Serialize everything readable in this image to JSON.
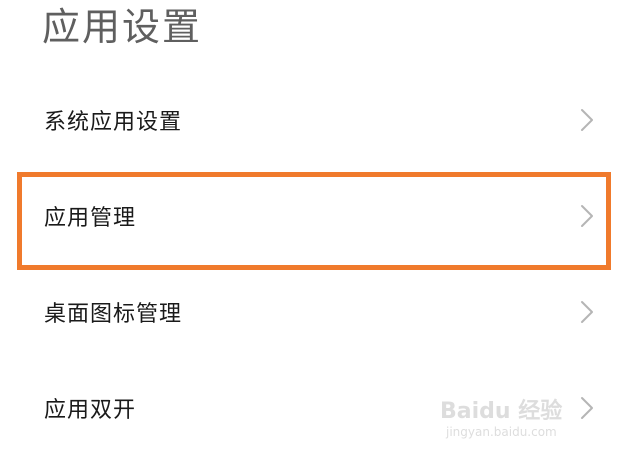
{
  "header": {
    "title": "应用设置"
  },
  "settings": {
    "items": [
      {
        "label": "系统应用设置",
        "icon": "chevron-right-icon"
      },
      {
        "label": "应用管理",
        "icon": "chevron-right-icon",
        "highlighted": true
      },
      {
        "label": "桌面图标管理",
        "icon": "chevron-right-icon"
      },
      {
        "label": "应用双开",
        "icon": "chevron-right-icon"
      }
    ]
  },
  "colors": {
    "highlight": "#f07a2c",
    "chevron": "#b5b5b5",
    "title": "#5f5f5f",
    "label": "#1a1a1a"
  },
  "watermark": {
    "brand_text": "Baidu 经验",
    "url": "jingyan.baidu.com"
  }
}
